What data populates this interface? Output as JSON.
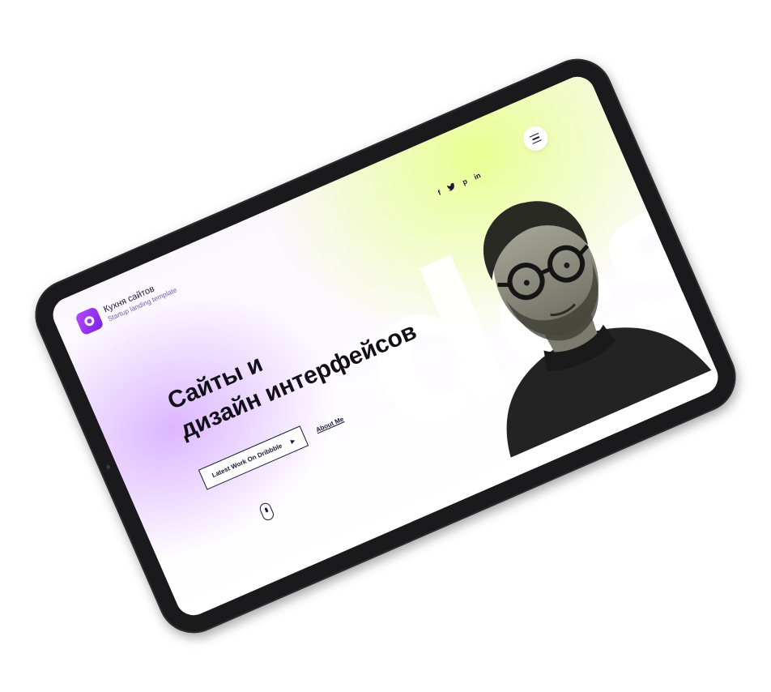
{
  "brand": {
    "name": "Кухня сайтов",
    "tagline": "Startup landing template"
  },
  "socials": {
    "facebook": "f",
    "twitter": "t",
    "pinterest": "p",
    "linkedin": "in"
  },
  "background_word": "des",
  "hero": {
    "line1": "Сайты и",
    "line2": "дизайн интерфейсов"
  },
  "cta": {
    "primary_label": "Latest Work On Dribbble",
    "primary_icon": "play-icon",
    "secondary_label": "About Me"
  },
  "icons": {
    "menu": "hamburger-menu-icon",
    "scroll": "mouse-scroll-icon"
  },
  "colors": {
    "accent": "#9b30ff",
    "lime_glow": "#e8ff8c",
    "lavender_glow": "#d6aaff",
    "ink": "#1b1533"
  }
}
